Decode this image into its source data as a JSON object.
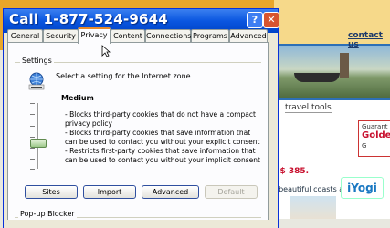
{
  "background_page": {
    "contact_link": "contact us",
    "travel_tools": "travel tools",
    "guarantee_text": "Guarant",
    "guarantee_brand": "Golde",
    "guarantee_more": "G",
    "price_text": "S$ 385.",
    "description_text": ", beautiful coasts a",
    "watermark": "iYogi"
  },
  "dialog": {
    "title": "Call 1-877-524-9644",
    "help_glyph": "?",
    "close_glyph": "✕",
    "tabs": [
      "General",
      "Security",
      "Privacy",
      "Content",
      "Connections",
      "Programs",
      "Advanced"
    ],
    "active_tab": "Privacy",
    "settings_group": "Settings",
    "zone_instruction": "Select a setting for the Internet zone.",
    "level_name": "Medium",
    "level_description": [
      "- Blocks third-party cookies that do not have a compact privacy policy",
      "- Blocks third-party cookies that save information that can be used to contact you without your explicit consent",
      "- Restricts first-party cookies that save information that can be used to contact you without your implicit consent"
    ],
    "slider_level": "Medium",
    "buttons": {
      "sites": "Sites",
      "import": "Import",
      "advanced": "Advanced",
      "default": "Default"
    },
    "popup_group": "Pop-up Blocker"
  },
  "colors": {
    "titlebar": "#0a56e0",
    "active_tab_accent": "#e68b2c",
    "dialog_face": "#ece9d8"
  }
}
